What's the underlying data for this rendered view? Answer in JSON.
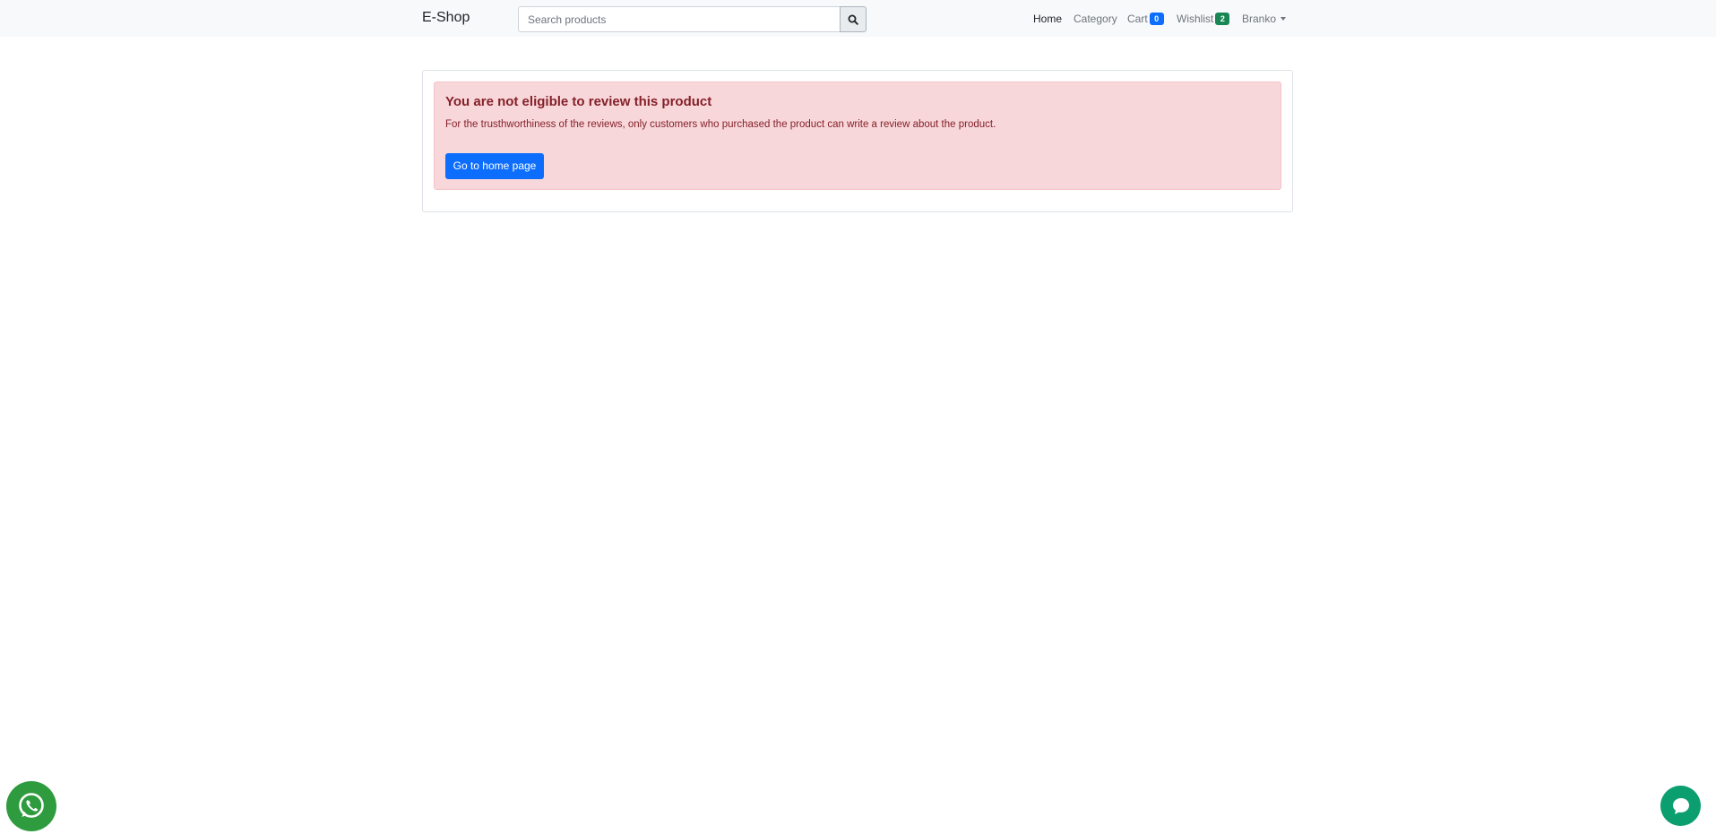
{
  "navbar": {
    "brand": "E-Shop",
    "search": {
      "placeholder": "Search products",
      "value": "",
      "button_icon": "search-icon"
    },
    "links": {
      "home": "Home",
      "category": "Category",
      "cart": "Cart",
      "cart_count": "0",
      "wishlist": "Wishlist",
      "wishlist_count": "2",
      "user": "Branko"
    }
  },
  "alert": {
    "title": "You are not eligible to review this product",
    "message": "For the trusthworthiness of the reviews, only customers who purchased the product can write a review about the product.",
    "button_label": "Go to home page"
  },
  "floating": {
    "left_icon": "whatsapp-icon",
    "right_icon": "chat-icon"
  },
  "colors": {
    "navbar_bg": "#f8f9fa",
    "alert_bg": "#f8d7da",
    "alert_text": "#842029",
    "primary": "#0d6efd",
    "success": "#198754",
    "whatsapp": "#2e9c3e",
    "chat": "#0b9f6f"
  }
}
